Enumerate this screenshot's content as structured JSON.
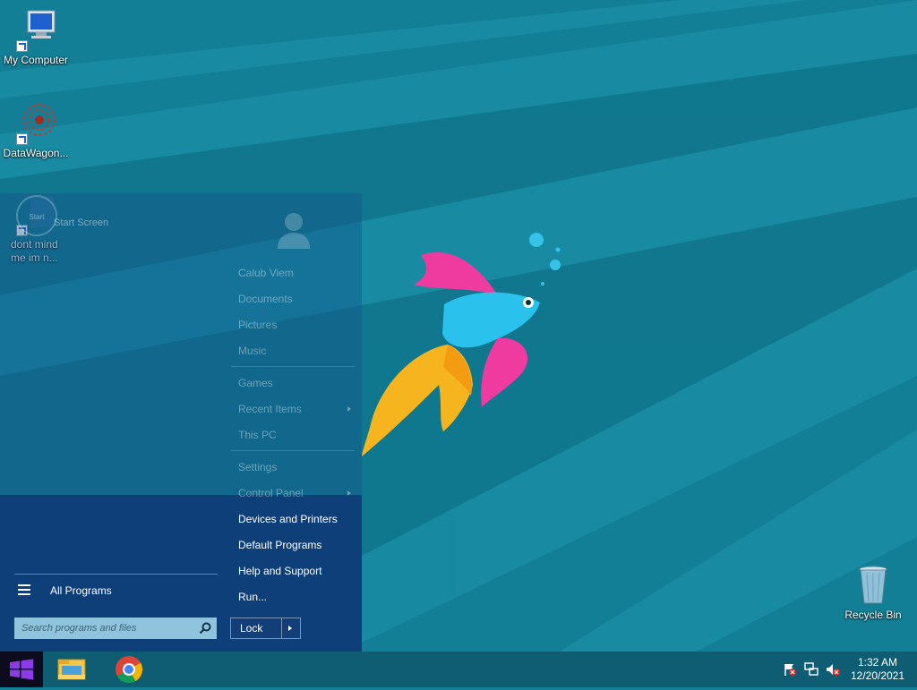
{
  "desktop": {
    "icons": [
      {
        "label": "My Computer",
        "icon": "computer-icon"
      },
      {
        "label": "DataWagon...",
        "icon": "datawagon-gear-icon"
      },
      {
        "label": "dont mind\nme im n...",
        "icon": "unknown-file-icon"
      },
      {
        "label": "Recycle Bin",
        "icon": "recycle-bin-icon"
      }
    ]
  },
  "start_menu": {
    "pinned": {
      "tile_text": "Start",
      "label": "Start Screen"
    },
    "all_programs": "All Programs",
    "search_placeholder": "Search programs and files",
    "user_items": [
      "Calub Viem",
      "Documents",
      "Pictures",
      "Music"
    ],
    "system_items": [
      "Games",
      "Recent Items",
      "This PC"
    ],
    "settings_items": [
      "Settings",
      "Control Panel"
    ],
    "lower_items": [
      "Devices and Printers",
      "Default Programs",
      "Help and Support",
      "Run..."
    ],
    "lock_label": "Lock"
  },
  "taskbar": {
    "buttons": [
      "start-button",
      "file-explorer-icon",
      "chrome-icon"
    ],
    "tray": [
      "action-center-flag-icon",
      "network-icon",
      "volume-muted-icon"
    ],
    "time": "1:32 AM",
    "date": "12/20/2021"
  },
  "colors": {
    "wallpaper": "#137f96",
    "start_menu_dark": "#0e3f78",
    "taskbar": "#0e5d73",
    "start_button": "#0c0c1e"
  }
}
